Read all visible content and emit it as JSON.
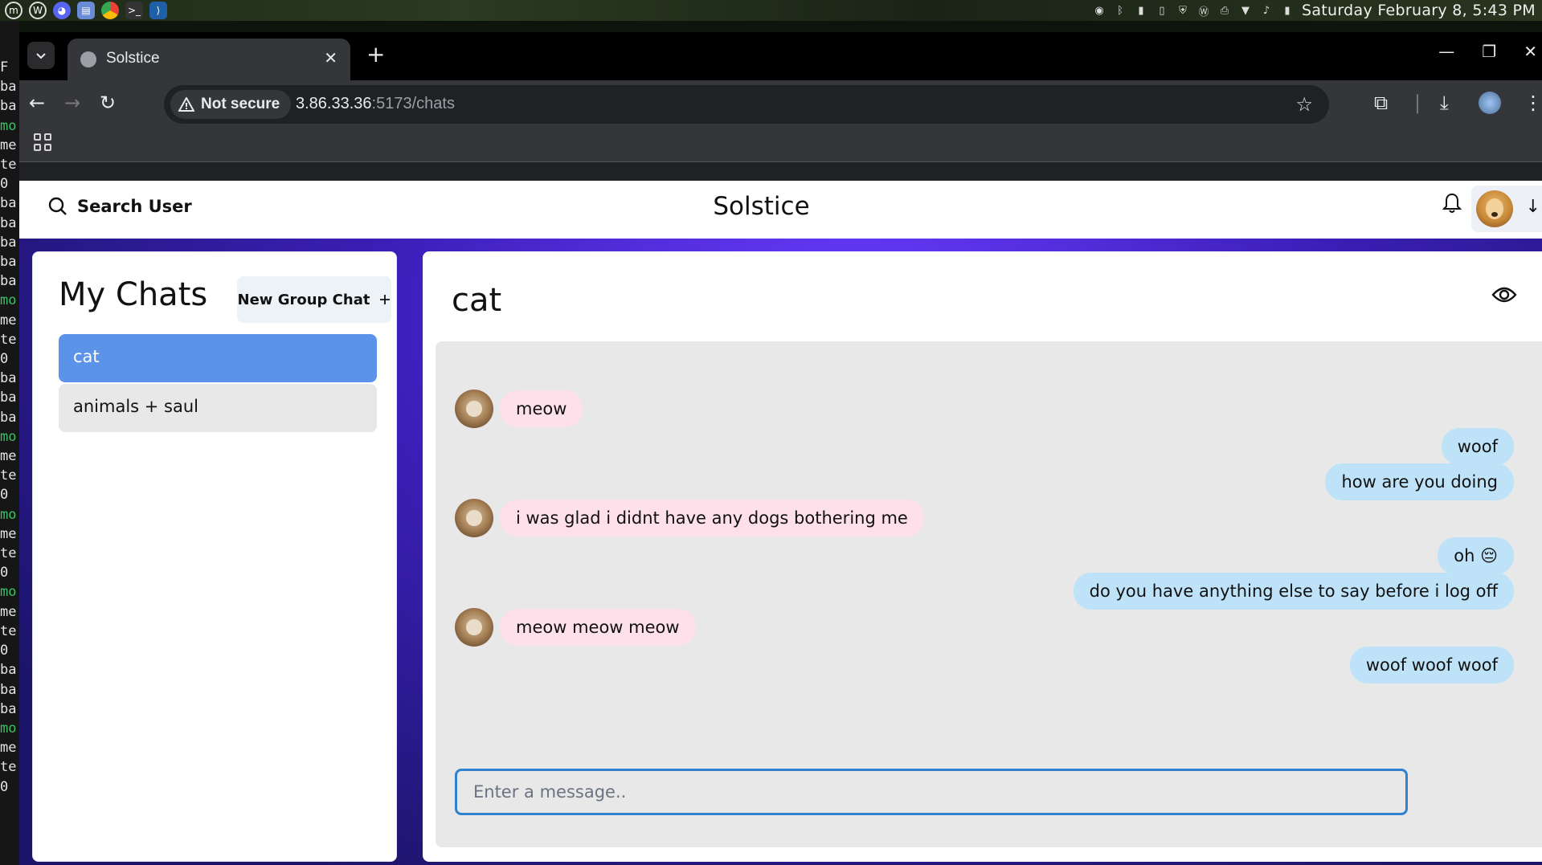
{
  "os_bar": {
    "apps": [
      "mint-menu-icon",
      "wordpress-icon",
      "discord-icon",
      "files-icon",
      "chrome-icon",
      "terminal-icon",
      "vscode-icon"
    ],
    "clock": "Saturday February  8,  5:43 PM"
  },
  "terminal": {
    "lines": [
      "F",
      "ba",
      "ba",
      "mo",
      "me",
      "te",
      " 0",
      "ba",
      "ba",
      "ba",
      "ba",
      "ba",
      "mo",
      "me",
      "te",
      " 0",
      "ba",
      "ba",
      "ba",
      "mo",
      "me",
      "te",
      " 0",
      "mo",
      "me",
      "te",
      " 0",
      "mo",
      "me",
      "te",
      " 0",
      "ba",
      "ba",
      "ba",
      "mo",
      "me",
      "te",
      " 0"
    ]
  },
  "browser": {
    "tab_title": "Solstice",
    "security_label": "Not secure",
    "url_host": "3.86.33.36",
    "url_rest": ":5173/chats"
  },
  "app": {
    "search_label": "Search User",
    "title": "Solstice"
  },
  "sidebar": {
    "title": "My Chats",
    "new_group_label": "New Group Chat",
    "chats": [
      {
        "name": "cat",
        "selected": true
      },
      {
        "name": "animals + saul",
        "selected": false
      }
    ]
  },
  "chat": {
    "title": "cat",
    "input_placeholder": "Enter a message..",
    "messages": [
      {
        "sender": "them",
        "text": "meow"
      },
      {
        "sender": "me",
        "text": "woof"
      },
      {
        "sender": "me",
        "text": "how are you doing"
      },
      {
        "sender": "them",
        "text": "i was glad i didnt have any dogs bothering me"
      },
      {
        "sender": "me",
        "text": "oh 😔"
      },
      {
        "sender": "me",
        "text": "do you have anything else to say before i log off"
      },
      {
        "sender": "them",
        "text": "meow meow meow"
      },
      {
        "sender": "me",
        "text": "woof woof woof"
      }
    ]
  },
  "colors": {
    "selected_chat": "#5b93e8",
    "unselected_chat": "#e8e8e8",
    "their_bubble": "#fde0ea",
    "my_bubble": "#bee3f8",
    "input_border": "#3182ce"
  }
}
